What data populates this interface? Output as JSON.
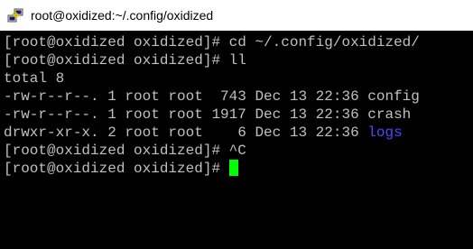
{
  "window": {
    "title": "root@oxidized:~/.config/oxidized",
    "icon": "putty-icon"
  },
  "terminal": {
    "colors": {
      "background": "#000000",
      "text": "#c0c0c0",
      "directory": "#4a4aff",
      "cursor": "#00ff00"
    },
    "lines": [
      {
        "text": "[root@oxidized oxidized]# cd ~/.config/oxidized/"
      },
      {
        "text": "[root@oxidized oxidized]# ll"
      },
      {
        "text": "total 8"
      },
      {
        "text": "-rw-r--r--. 1 root root  743 Dec 13 22:36 config"
      },
      {
        "text": "-rw-r--r--. 1 root root 1917 Dec 13 22:36 crash"
      },
      {
        "prefix": "drwxr-xr-x. 2 root root    6 Dec 13 22:36 ",
        "dir": "logs"
      },
      {
        "text": "[root@oxidized oxidized]# ^C"
      },
      {
        "prompt": "[root@oxidized oxidized]# "
      }
    ]
  }
}
